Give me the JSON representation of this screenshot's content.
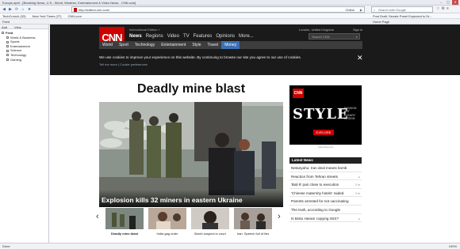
{
  "window": {
    "title": "Europe-april - [Breaking News, U.S., World, Weather, Entertainment & Video News - CNN.com]",
    "controls": [
      "–",
      "▢",
      "✕"
    ]
  },
  "browser": {
    "nav_buttons": [
      "◀",
      "▶",
      "⟳",
      "⌂",
      "★"
    ],
    "url": "http://edition.cnn.com/",
    "status": "Online",
    "search_placeholder": "Search with Google",
    "tool_icons": [
      "☆",
      "⚙",
      "≡"
    ]
  },
  "favorites": {
    "items": [
      "TechCrunch (33)",
      "New York Times (27)",
      "CNN.com"
    ],
    "right_note": "Post Draft: Senate Panel Expected to Dr..."
  },
  "commandbar": {
    "feed_label": "Feed",
    "tab_info": "Home Page"
  },
  "sidebar": {
    "add_label": "Add",
    "view_label": "View",
    "root": "Feed",
    "children": [
      "World & Business",
      "Sports",
      "Entertainment",
      "Science",
      "Technology",
      "Gaming"
    ]
  },
  "cnn": {
    "logo": "CNN",
    "edition": "International Edition +",
    "nav": [
      "News",
      "Regions",
      "Video",
      "TV",
      "Features",
      "Opinions",
      "More..."
    ],
    "location": "London, United Kingdom",
    "signin": "Sign in",
    "search_placeholder": "Search CNN",
    "subnav": [
      "World",
      "Sport",
      "Technology",
      "Entertainment",
      "Style",
      "Travel",
      "Money"
    ]
  },
  "cookie": {
    "message": "We use cookies to improve your experience on this website. By continuing to browse our site you agree to our use of cookies.",
    "links": "Tell me more | Cookie preferences",
    "close": "✕"
  },
  "headline": "Deadly mine blast",
  "hero_caption": "Explosion kills 32 miners in eastern Ukraine",
  "carousel": {
    "prev": "‹",
    "next": "›",
    "items": [
      {
        "label": "Deadly mine blast",
        "active": true
      },
      {
        "label": "India gag order",
        "active": false
      },
      {
        "label": "Bomb suspect in court",
        "active": false
      },
      {
        "label": "Iran: Speech full of lies",
        "active": false
      }
    ]
  },
  "ad": {
    "mini_logo": "CNN",
    "style_text": "STYLE",
    "tagline": [
      "FASHION",
      "ART",
      "LUXURY",
      "DESIGN"
    ],
    "explore": "EXPLORE",
    "label": "Advertisement"
  },
  "latest": {
    "heading": "Latest News",
    "items": [
      {
        "text": "Netanyahu: Iran deal means bomb",
        "tag": ""
      },
      {
        "text": "Reaction from Tehran streets",
        "tag": "▸"
      },
      {
        "text": "'Bali 9' pair close to execution",
        "tag": "2 hr"
      },
      {
        "text": "'Chinese maternity hotels' raided",
        "tag": "3 hr"
      },
      {
        "text": "Parents arrested for not vaccinating",
        "tag": ""
      },
      {
        "text": "The truth, according to Google",
        "tag": ""
      },
      {
        "text": "Is Boko Haram copying ISIS?",
        "tag": "▸"
      }
    ]
  },
  "statusbar": {
    "status": "Done",
    "zoom": "100%"
  }
}
